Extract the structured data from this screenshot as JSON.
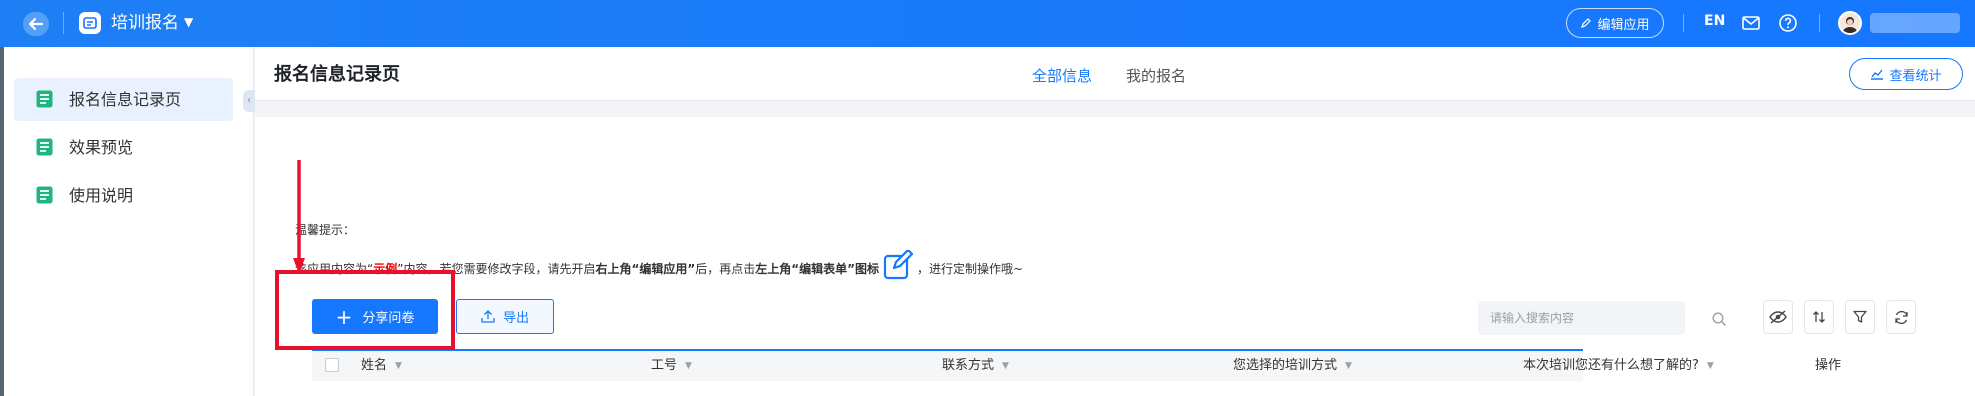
{
  "topbar": {
    "app_title": "培训报名",
    "edit_app_label": "编辑应用",
    "lang": "EN"
  },
  "sidebar": {
    "items": [
      {
        "label": "报名信息记录页",
        "active": true
      },
      {
        "label": "效果预览",
        "active": false
      },
      {
        "label": "使用说明",
        "active": false
      }
    ]
  },
  "header": {
    "page_title": "报名信息记录页",
    "tabs": [
      {
        "label": "全部信息",
        "active": true
      },
      {
        "label": "我的报名",
        "active": false
      }
    ],
    "stats_label": "查看统计"
  },
  "tip": {
    "title": "温馨提示：",
    "part1": "该应用内容为“",
    "example": "示例",
    "part2": "”内容，若您需要修改字段，请先开启",
    "bold1": "右上角“编辑应用”",
    "part3": "后，再点击",
    "bold2": "左上角“编辑表单”图标",
    "part4": "，进行定制操作哦~"
  },
  "toolbar": {
    "share_label": "分享问卷",
    "export_label": "导出",
    "search_placeholder": "请输入搜索内容"
  },
  "table": {
    "columns": [
      "姓名",
      "工号",
      "联系方式",
      "您选择的培训方式",
      "本次培训您还有什么想了解的?",
      "操作"
    ]
  },
  "colors": {
    "primary": "#1677ff",
    "annotation": "#e8112d",
    "sidebar_icon": "#1fb57f"
  }
}
